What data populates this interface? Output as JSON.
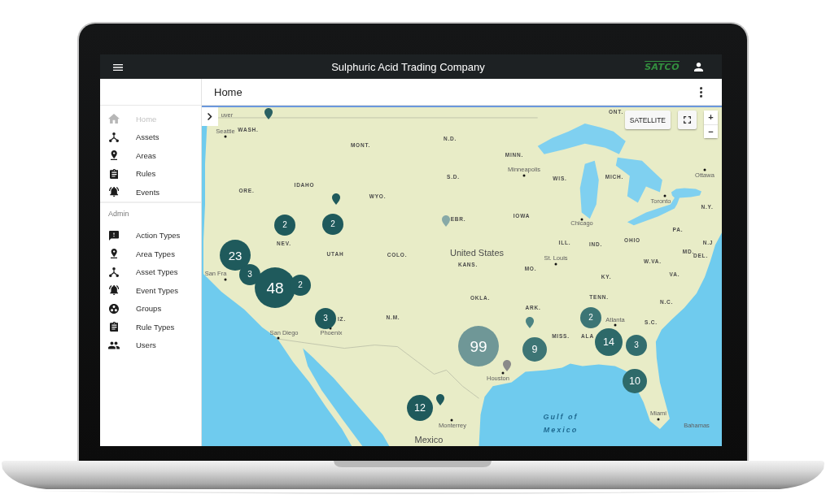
{
  "app_bar": {
    "title": "Sulphuric Acid Trading Company",
    "logo": "SATCO"
  },
  "page_header": {
    "title": "Home"
  },
  "sidebar": {
    "items": [
      {
        "label": "Home",
        "selected": true
      },
      {
        "label": "Assets",
        "selected": false
      },
      {
        "label": "Areas",
        "selected": false
      },
      {
        "label": "Rules",
        "selected": false
      },
      {
        "label": "Events",
        "selected": false
      }
    ],
    "sections": [
      {
        "heading": "Admin",
        "items": [
          {
            "label": "Action Types",
            "selected": false
          },
          {
            "label": "Area Types",
            "selected": false
          },
          {
            "label": "Asset Types",
            "selected": false
          },
          {
            "label": "Event Types",
            "selected": false
          },
          {
            "label": "Groups",
            "selected": false
          },
          {
            "label": "Rule Types",
            "selected": false
          },
          {
            "label": "Users",
            "selected": false
          }
        ]
      }
    ]
  },
  "map": {
    "controls": {
      "map_type": "SATELLITE",
      "zoom_in": "+",
      "zoom_out": "−"
    },
    "labels": [
      {
        "text": "uver",
        "kind": "city"
      },
      {
        "text": "ONT.",
        "kind": "state"
      },
      {
        "text": "Seattle",
        "kind": "city"
      },
      {
        "text": "WASH.",
        "kind": "state"
      },
      {
        "text": "N.D.",
        "kind": "state"
      },
      {
        "text": "MONT.",
        "kind": "state"
      },
      {
        "text": "MINN.",
        "kind": "state"
      },
      {
        "text": "Minneapolis",
        "kind": "city"
      },
      {
        "text": "S.D.",
        "kind": "state"
      },
      {
        "text": "WIS.",
        "kind": "state"
      },
      {
        "text": "MICH.",
        "kind": "state"
      },
      {
        "text": "Ottawa",
        "kind": "city"
      },
      {
        "text": "IDAHO",
        "kind": "state"
      },
      {
        "text": "ORE.",
        "kind": "state"
      },
      {
        "text": "WYO.",
        "kind": "state"
      },
      {
        "text": "Toronto",
        "kind": "city"
      },
      {
        "text": "N.Y.",
        "kind": "state"
      },
      {
        "text": "EBR.",
        "kind": "state"
      },
      {
        "text": "IOWA",
        "kind": "state"
      },
      {
        "text": "Chicago",
        "kind": "city"
      },
      {
        "text": "PA.",
        "kind": "state"
      },
      {
        "text": "NEV.",
        "kind": "state"
      },
      {
        "text": "ILL.",
        "kind": "state"
      },
      {
        "text": "IND.",
        "kind": "state"
      },
      {
        "text": "OHIO",
        "kind": "state"
      },
      {
        "text": "N.J",
        "kind": "state"
      },
      {
        "text": "UTAH",
        "kind": "state"
      },
      {
        "text": "COLO.",
        "kind": "state"
      },
      {
        "text": "United States",
        "kind": "country"
      },
      {
        "text": "MD.",
        "kind": "state"
      },
      {
        "text": "St. Louis",
        "kind": "city"
      },
      {
        "text": "DEL.",
        "kind": "state"
      },
      {
        "text": "KANS.",
        "kind": "state"
      },
      {
        "text": "W.VA.",
        "kind": "state"
      },
      {
        "text": "San Fra",
        "kind": "city"
      },
      {
        "text": "MO.",
        "kind": "state"
      },
      {
        "text": "KY.",
        "kind": "state"
      },
      {
        "text": "VA.",
        "kind": "state"
      },
      {
        "text": "OKLA.",
        "kind": "state"
      },
      {
        "text": "TENN.",
        "kind": "state"
      },
      {
        "text": "N.C.",
        "kind": "state"
      },
      {
        "text": "ARK.",
        "kind": "state"
      },
      {
        "text": "IZ.",
        "kind": "state"
      },
      {
        "text": "N.M.",
        "kind": "state"
      },
      {
        "text": "Atlanta",
        "kind": "city"
      },
      {
        "text": "S.C.",
        "kind": "state"
      },
      {
        "text": "San Diego",
        "kind": "city"
      },
      {
        "text": "Phoenix",
        "kind": "city"
      },
      {
        "text": "MISS.",
        "kind": "state"
      },
      {
        "text": "ALA",
        "kind": "state"
      },
      {
        "text": "Houston",
        "kind": "city"
      },
      {
        "text": "Gulf of",
        "kind": "water"
      },
      {
        "text": "Miami",
        "kind": "city"
      },
      {
        "text": "Monterrey",
        "kind": "city"
      },
      {
        "text": "Mexico",
        "kind": "water"
      },
      {
        "text": "Bahamas",
        "kind": "city"
      },
      {
        "text": "Mexico",
        "kind": "country"
      }
    ],
    "markers": [
      {
        "kind": "pin",
        "color": "#2a6163"
      },
      {
        "kind": "pin",
        "color": "#1f5a5c"
      },
      {
        "kind": "pin",
        "color": "#87a9a7"
      },
      {
        "kind": "cluster",
        "count": "2",
        "color": "#1f5a5c"
      },
      {
        "kind": "cluster",
        "count": "2",
        "color": "#1f5a5c"
      },
      {
        "kind": "cluster",
        "count": "23",
        "color": "#1f5a5c"
      },
      {
        "kind": "cluster",
        "count": "3",
        "color": "#1f5a5c"
      },
      {
        "kind": "cluster",
        "count": "48",
        "color": "#1f5a5c"
      },
      {
        "kind": "cluster",
        "count": "2",
        "color": "#1f5a5c"
      },
      {
        "kind": "cluster",
        "count": "3",
        "color": "#1f5a5c"
      },
      {
        "kind": "pin",
        "color": "#4b8383"
      },
      {
        "kind": "cluster",
        "count": "2",
        "color": "#3c7575"
      },
      {
        "kind": "cluster",
        "count": "99",
        "color": "#6f9797"
      },
      {
        "kind": "cluster",
        "count": "14",
        "color": "#2d6969"
      },
      {
        "kind": "cluster",
        "count": "3",
        "color": "#326d6e"
      },
      {
        "kind": "cluster",
        "count": "9",
        "color": "#3d7575"
      },
      {
        "kind": "pin",
        "color": "#8a8a8a"
      },
      {
        "kind": "cluster",
        "count": "10",
        "color": "#2e6a6a"
      },
      {
        "kind": "pin",
        "color": "#1f5a5c"
      },
      {
        "kind": "cluster",
        "count": "12",
        "color": "#1f5a5c"
      }
    ]
  }
}
